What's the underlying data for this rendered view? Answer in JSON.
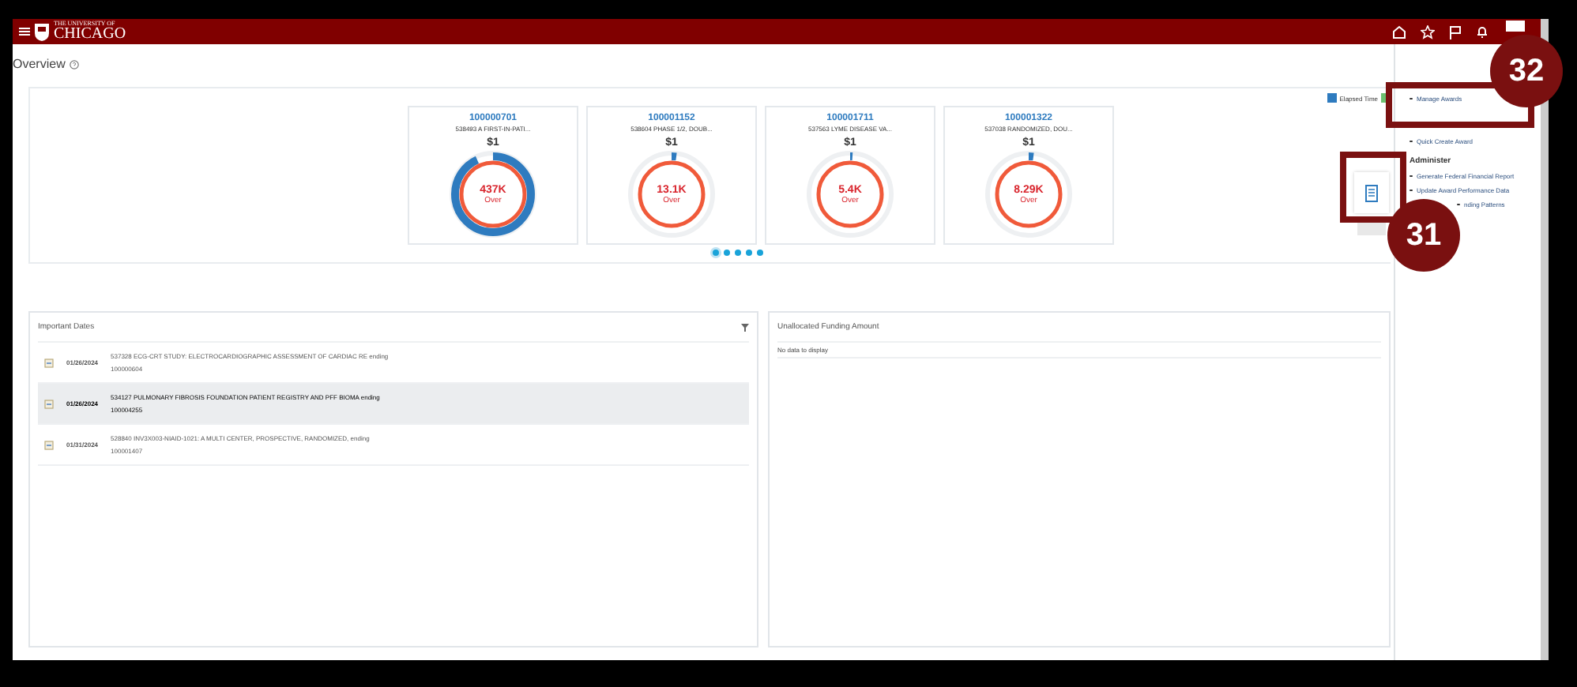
{
  "header": {
    "logo_top": "THE UNIVERSITY OF",
    "logo_main": "CHICAGO"
  },
  "page": {
    "title": "Overview"
  },
  "legend": [
    {
      "label": "Elapsed Time",
      "color": "#2e7bbf"
    },
    {
      "color": "#6cc070"
    }
  ],
  "awards": [
    {
      "number": "100000701",
      "name": "538493 A FIRST-IN-PATI...",
      "amount": "$1",
      "value": "437K",
      "status": "Over",
      "level": 0.93
    },
    {
      "number": "100001152",
      "name": "538604 PHASE 1/2, DOUB...",
      "amount": "$1",
      "value": "13.1K",
      "status": "Over",
      "level": 0.02
    },
    {
      "number": "100001711",
      "name": "537563 LYME DISEASE VA...",
      "amount": "$1",
      "value": "5.4K",
      "status": "Over",
      "level": 0.01
    },
    {
      "number": "100001322",
      "name": "537038 RANDOMIZED, DOU...",
      "amount": "$1",
      "value": "8.29K",
      "status": "Over",
      "level": 0.02
    }
  ],
  "pager": [
    {
      "selected": true
    },
    {
      "selected": false
    },
    {
      "selected": false
    },
    {
      "selected": false
    },
    {
      "selected": false
    }
  ],
  "important_dates": {
    "title": "Important Dates",
    "rows": [
      {
        "date": "01/26/2024",
        "text": "537328 ECG-CRT STUDY: ELECTROCARDIOGRAPHIC ASSESSMENT OF CARDIAC RE ending",
        "award": "100000604",
        "selected": false
      },
      {
        "date": "01/26/2024",
        "text": "534127 PULMONARY FIBROSIS FOUNDATION PATIENT REGISTRY AND PFF BIOMA ending",
        "award": "100004255",
        "selected": true
      },
      {
        "date": "01/31/2024",
        "text": "528840 INV3X003-NIAID-1021: A MULTI CENTER, PROSPECTIVE, RANDOMIZED, ending",
        "award": "100001407",
        "selected": false
      }
    ]
  },
  "unallocated_funding": {
    "title": "Unallocated Funding Amount",
    "message": "No data to display"
  },
  "sidebar": {
    "items": [
      {
        "kind": "link",
        "label": "Manage Awards"
      },
      {
        "kind": "link",
        "label": "Quick Create Award"
      },
      {
        "kind": "heading",
        "label": "Administer"
      },
      {
        "kind": "link",
        "label": "Generate Federal Financial Report"
      },
      {
        "kind": "link",
        "label": "Update Award Performance Data"
      },
      {
        "kind": "link",
        "label": "nding Patterns"
      }
    ]
  },
  "callouts": [
    {
      "label": "32"
    },
    {
      "label": "31"
    }
  ]
}
